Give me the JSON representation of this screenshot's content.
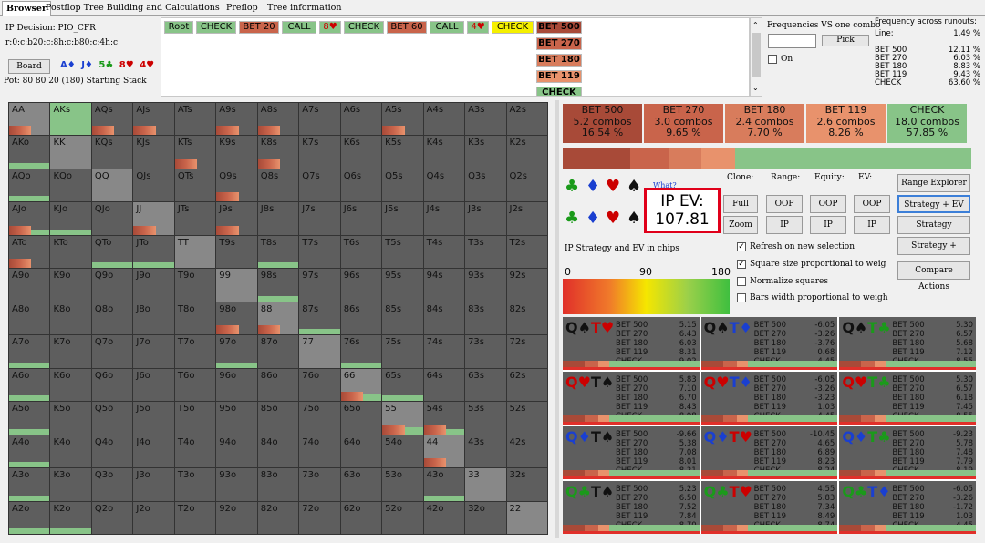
{
  "tabs": [
    {
      "label": "Browser",
      "active": true
    },
    {
      "label": "Postflop Tree Building and Calculations"
    },
    {
      "label": "Preflop"
    },
    {
      "label": "Tree information"
    }
  ],
  "info": {
    "decision": "IP Decision:  PIO_CFR",
    "line": "r:0:c:b20:c:8h:c:b80:c:4h:c",
    "board_label": "Board",
    "board_cards": [
      "A♦",
      "J♦",
      "5♣",
      "8♥",
      "4♥"
    ],
    "pot": "Pot: 80 80 20 (180) Starting Stack"
  },
  "tree": {
    "row1": [
      "Root",
      "CHECK",
      "BET 20",
      "CALL",
      "8♥",
      "CHECK",
      "BET 60",
      "CALL",
      "4♥",
      "CHECK",
      "BET 500"
    ],
    "col": [
      "BET 270",
      "BET 180",
      "BET 119",
      "CHECK"
    ]
  },
  "freq": {
    "title": "Frequencies VS one combo",
    "pick": "Pick",
    "on": "On",
    "runouts_title": "Frequency across runouts:",
    "rows": [
      [
        "Line:",
        "1.49 %"
      ],
      [
        "",
        ""
      ],
      [
        "BET 500",
        "12.11 %"
      ],
      [
        "BET 270",
        "6.03 %"
      ],
      [
        "BET 180",
        "8.83 %"
      ],
      [
        "BET 119",
        "9.43 %"
      ],
      [
        "CHECK",
        "63.60 %"
      ]
    ]
  },
  "actions": [
    {
      "name": "BET 500",
      "combos": "5.2 combos",
      "pct": "16.54 %",
      "color": "#a84a38"
    },
    {
      "name": "BET 270",
      "combos": "3.0 combos",
      "pct": "9.65 %",
      "color": "#c9644b"
    },
    {
      "name": "BET 180",
      "combos": "2.4 combos",
      "pct": "7.70 %",
      "color": "#d87c5c"
    },
    {
      "name": "BET 119",
      "combos": "2.6 combos",
      "pct": "8.26 %",
      "color": "#e8926c"
    },
    {
      "name": "CHECK",
      "combos": "18.0 combos",
      "pct": "57.85 %",
      "color": "#88c488"
    }
  ],
  "action_fractions": [
    0.1654,
    0.0965,
    0.077,
    0.0826,
    0.5785
  ],
  "controls": {
    "what": "What?",
    "ev_label": "IP EV:",
    "ev_value": "107.81",
    "clone": "Clone:",
    "range": "Range:",
    "equity": "Equity:",
    "ev": "EV:",
    "full": "Full",
    "zoom": "Zoom",
    "oop": "OOP",
    "ip": "IP",
    "btns": [
      "Range Explorer",
      "Strategy + EV",
      "Strategy",
      "Strategy +",
      "Compare Actions"
    ],
    "strategy_caption": "IP Strategy and EV in chips",
    "scale": [
      "0",
      "90",
      "180"
    ],
    "checks": [
      {
        "label": "Refresh on new selection",
        "on": true
      },
      {
        "label": "Square size proportional to weig",
        "on": true
      },
      {
        "label": "Normalize squares",
        "on": false
      },
      {
        "label": "Bars width proportional to weigh",
        "on": false
      }
    ]
  },
  "grid": [
    "AA",
    "AKs",
    "AQs",
    "AJs",
    "ATs",
    "A9s",
    "A8s",
    "A7s",
    "A6s",
    "A5s",
    "A4s",
    "A3s",
    "A2s",
    "AKo",
    "KK",
    "KQs",
    "KJs",
    "KTs",
    "K9s",
    "K8s",
    "K7s",
    "K6s",
    "K5s",
    "K4s",
    "K3s",
    "K2s",
    "AQo",
    "KQo",
    "QQ",
    "QJs",
    "QTs",
    "Q9s",
    "Q8s",
    "Q7s",
    "Q6s",
    "Q5s",
    "Q4s",
    "Q3s",
    "Q2s",
    "AJo",
    "KJo",
    "QJo",
    "JJ",
    "JTs",
    "J9s",
    "J8s",
    "J7s",
    "J6s",
    "J5s",
    "J4s",
    "J3s",
    "J2s",
    "ATo",
    "KTo",
    "QTo",
    "JTo",
    "TT",
    "T9s",
    "T8s",
    "T7s",
    "T6s",
    "T5s",
    "T4s",
    "T3s",
    "T2s",
    "A9o",
    "K9o",
    "Q9o",
    "J9o",
    "T9o",
    "99",
    "98s",
    "97s",
    "96s",
    "95s",
    "94s",
    "93s",
    "92s",
    "A8o",
    "K8o",
    "Q8o",
    "J8o",
    "T8o",
    "98o",
    "88",
    "87s",
    "86s",
    "85s",
    "84s",
    "83s",
    "82s",
    "A7o",
    "K7o",
    "Q7o",
    "J7o",
    "T7o",
    "97o",
    "87o",
    "77",
    "76s",
    "75s",
    "74s",
    "73s",
    "72s",
    "A6o",
    "K6o",
    "Q6o",
    "J6o",
    "T6o",
    "96o",
    "86o",
    "76o",
    "66",
    "65s",
    "64s",
    "63s",
    "62s",
    "A5o",
    "K5o",
    "Q5o",
    "J5o",
    "T5o",
    "95o",
    "85o",
    "75o",
    "65o",
    "55",
    "54s",
    "53s",
    "52s",
    "A4o",
    "K4o",
    "Q4o",
    "J4o",
    "T4o",
    "94o",
    "84o",
    "74o",
    "64o",
    "54o",
    "44",
    "43s",
    "42s",
    "A3o",
    "K3o",
    "Q3o",
    "J3o",
    "T3o",
    "93o",
    "83o",
    "73o",
    "63o",
    "53o",
    "43o",
    "33",
    "32s",
    "A2o",
    "K2o",
    "Q2o",
    "J2o",
    "T2o",
    "92o",
    "82o",
    "72o",
    "62o",
    "52o",
    "42o",
    "32o",
    "22"
  ],
  "combos": [
    {
      "c1": "Q♠",
      "c2": "T♥",
      "k1": "#111",
      "k2": "#c00",
      "rows": [
        [
          "BET 500",
          "5.15"
        ],
        [
          "BET 270",
          "6.43"
        ],
        [
          "BET 180",
          "6.03"
        ],
        [
          "BET 119",
          "8.31"
        ],
        [
          "CHECK",
          "9.02"
        ]
      ]
    },
    {
      "c1": "Q♠",
      "c2": "T♦",
      "k1": "#111",
      "k2": "#1a3fd0",
      "rows": [
        [
          "BET 500",
          "-6.05"
        ],
        [
          "BET 270",
          "-3.26"
        ],
        [
          "BET 180",
          "-3.76"
        ],
        [
          "BET 119",
          "0.68"
        ],
        [
          "CHECK",
          "4.45"
        ]
      ]
    },
    {
      "c1": "Q♠",
      "c2": "T♣",
      "k1": "#111",
      "k2": "#1a9a1a",
      "rows": [
        [
          "BET 500",
          "5.30"
        ],
        [
          "BET 270",
          "6.57"
        ],
        [
          "BET 180",
          "5.68"
        ],
        [
          "BET 119",
          "7.12"
        ],
        [
          "CHECK",
          "8.55"
        ]
      ]
    },
    {
      "c1": "Q♥",
      "c2": "T♠",
      "k1": "#c00",
      "k2": "#111",
      "rows": [
        [
          "BET 500",
          "5.83"
        ],
        [
          "BET 270",
          "7.10"
        ],
        [
          "BET 180",
          "6.70"
        ],
        [
          "BET 119",
          "8.43"
        ],
        [
          "CHECK",
          "8.98"
        ]
      ]
    },
    {
      "c1": "Q♥",
      "c2": "T♦",
      "k1": "#c00",
      "k2": "#1a3fd0",
      "rows": [
        [
          "BET 500",
          "-6.05"
        ],
        [
          "BET 270",
          "-3.26"
        ],
        [
          "BET 180",
          "-3.23"
        ],
        [
          "BET 119",
          "1.03"
        ],
        [
          "CHECK",
          "4.45"
        ]
      ]
    },
    {
      "c1": "Q♥",
      "c2": "T♣",
      "k1": "#c00",
      "k2": "#1a9a1a",
      "rows": [
        [
          "BET 500",
          "5.30"
        ],
        [
          "BET 270",
          "6.57"
        ],
        [
          "BET 180",
          "6.18"
        ],
        [
          "BET 119",
          "7.45"
        ],
        [
          "CHECK",
          "8.55"
        ]
      ]
    },
    {
      "c1": "Q♦",
      "c2": "T♠",
      "k1": "#1a3fd0",
      "k2": "#111",
      "rows": [
        [
          "BET 500",
          "-9.66"
        ],
        [
          "BET 270",
          "5.38"
        ],
        [
          "BET 180",
          "7.08"
        ],
        [
          "BET 119",
          "8.01"
        ],
        [
          "CHECK",
          "8.21"
        ]
      ]
    },
    {
      "c1": "Q♦",
      "c2": "T♥",
      "k1": "#1a3fd0",
      "k2": "#c00",
      "rows": [
        [
          "BET 500",
          "-10.45"
        ],
        [
          "BET 270",
          "4.65"
        ],
        [
          "BET 180",
          "6.89"
        ],
        [
          "BET 119",
          "8.23"
        ],
        [
          "CHECK",
          "8.24"
        ]
      ]
    },
    {
      "c1": "Q♦",
      "c2": "T♣",
      "k1": "#1a3fd0",
      "k2": "#1a9a1a",
      "rows": [
        [
          "BET 500",
          "-9.23"
        ],
        [
          "BET 270",
          "5.78"
        ],
        [
          "BET 180",
          "7.48"
        ],
        [
          "BET 119",
          "7.79"
        ],
        [
          "CHECK",
          "8.19"
        ]
      ]
    },
    {
      "c1": "Q♣",
      "c2": "T♠",
      "k1": "#1a9a1a",
      "k2": "#111",
      "rows": [
        [
          "BET 500",
          "5.23"
        ],
        [
          "BET 270",
          "6.50"
        ],
        [
          "BET 180",
          "7.52"
        ],
        [
          "BET 119",
          "7.84"
        ],
        [
          "CHECK",
          "8.70"
        ]
      ]
    },
    {
      "c1": "Q♣",
      "c2": "T♥",
      "k1": "#1a9a1a",
      "k2": "#c00",
      "rows": [
        [
          "BET 500",
          "4.55"
        ],
        [
          "BET 270",
          "5.83"
        ],
        [
          "BET 180",
          "7.34"
        ],
        [
          "BET 119",
          "8.49"
        ],
        [
          "CHECK",
          "8.74"
        ]
      ]
    },
    {
      "c1": "Q♣",
      "c2": "T♦",
      "k1": "#1a9a1a",
      "k2": "#1a3fd0",
      "rows": [
        [
          "BET 500",
          "-6.05"
        ],
        [
          "BET 270",
          "-3.26"
        ],
        [
          "BET 180",
          "-1.72"
        ],
        [
          "BET 119",
          "1.03"
        ],
        [
          "CHECK",
          "4.45"
        ]
      ]
    }
  ]
}
